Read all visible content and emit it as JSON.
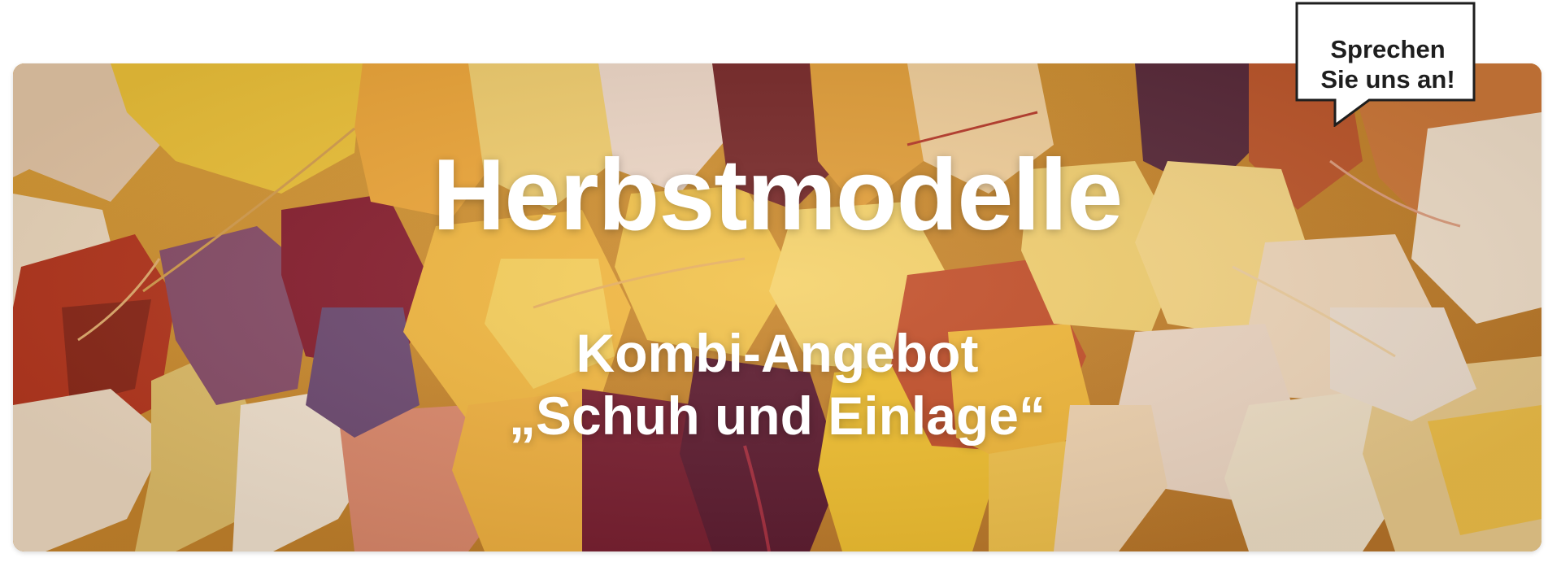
{
  "banner": {
    "headline": "Herbstmodelle",
    "subline_1": "Kombi-Angebot",
    "subline_2": "„Schuh und Einlage“",
    "background": "autumn-leaves-photo"
  },
  "speech_bubble": {
    "line_1": "Sprechen",
    "line_2": "Sie uns an!"
  },
  "colors": {
    "text_on_image": "#ffffff",
    "bubble_border": "#1e1e1e",
    "bubble_fill": "#ffffff"
  }
}
